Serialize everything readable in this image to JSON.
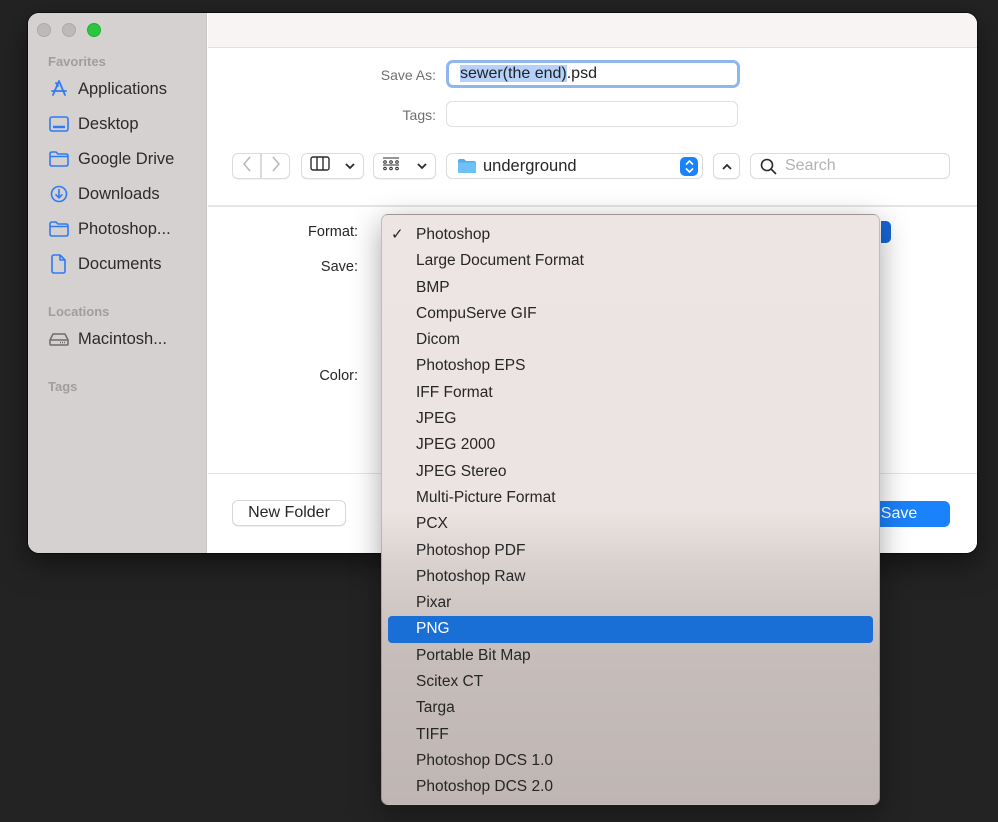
{
  "window": {
    "traffic_lights": [
      "close",
      "minimize",
      "zoom"
    ]
  },
  "sidebar": {
    "favorites_label": "Favorites",
    "favorites": [
      {
        "label": "Applications",
        "icon": "applications-icon"
      },
      {
        "label": "Desktop",
        "icon": "desktop-icon"
      },
      {
        "label": "Google Drive",
        "icon": "folder-icon"
      },
      {
        "label": "Downloads",
        "icon": "downloads-icon"
      },
      {
        "label": "Photoshop...",
        "icon": "folder-icon"
      },
      {
        "label": "Documents",
        "icon": "document-icon"
      }
    ],
    "locations_label": "Locations",
    "locations": [
      {
        "label": "Macintosh...",
        "icon": "hard-drive-icon"
      }
    ],
    "tags_label": "Tags"
  },
  "form": {
    "save_as_label": "Save As:",
    "save_as_value_selected": "sewer(the end)",
    "save_as_value_rest": ".psd",
    "tags_label": "Tags:",
    "tags_value": "",
    "format_label": "Format:",
    "save_label": "Save:",
    "color_label": "Color:"
  },
  "toolbar": {
    "back": "back",
    "forward": "forward",
    "view_mode": "column-view",
    "group_mode": "icon-grid",
    "location": "underground",
    "search_placeholder": "Search"
  },
  "buttons": {
    "new_folder": "New Folder",
    "save": "Save"
  },
  "format_menu": {
    "checked": "Photoshop",
    "highlighted": "PNG",
    "items": [
      "Photoshop",
      "Large Document Format",
      "BMP",
      "CompuServe GIF",
      "Dicom",
      "Photoshop EPS",
      "IFF Format",
      "JPEG",
      "JPEG 2000",
      "JPEG Stereo",
      "Multi-Picture Format",
      "PCX",
      "Photoshop PDF",
      "Photoshop Raw",
      "Pixar",
      "PNG",
      "Portable Bit Map",
      "Scitex CT",
      "Targa",
      "TIFF",
      "Photoshop DCS 1.0",
      "Photoshop DCS 2.0"
    ]
  },
  "colors": {
    "accent": "#1a82fb",
    "menu_highlight": "#1a6fd6",
    "sidebar_icon": "#2f7bf5",
    "zoom_light": "#2ac63f"
  }
}
